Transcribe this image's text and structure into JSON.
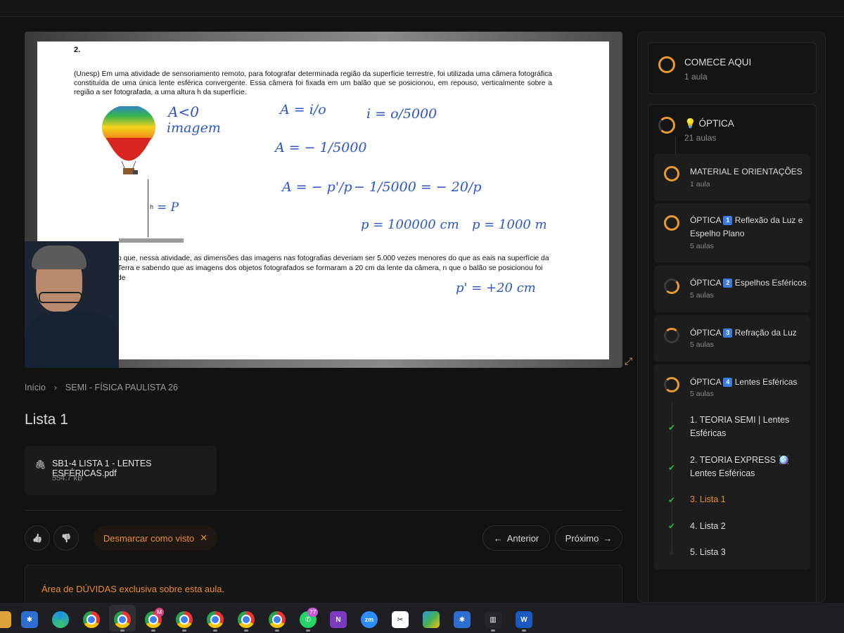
{
  "video": {
    "question_number": "2.",
    "question_text": "(Unesp)  Em uma atividade de sensoriamento remoto, para fotografar determinada região da superfície terrestre, foi utilizada uma câmera fotográfica constituída de uma única lente esférica convergente. Essa câmera foi fixada em um balão que se posicionou, em repouso, verticalmente sobre a região a ser fotografada, a uma altura h da superfície.",
    "question_text_2": "o que, nessa atividade, as dimensões das imagens nas fotografias deveriam ser 5.000 vezes menores do que as eais na superfície da Terra e sabendo que as imagens dos objetos fotografados se formaram a 20 cm da lente da câmera, n que o balão se posicionou foi de",
    "h_label": "h",
    "handwriting": {
      "a1": "A<0",
      "a2": "imagem",
      "a3": "A = i/o",
      "a4": "i = o/5000",
      "a5": "A = − 1/5000",
      "a6": "A = − p'/p",
      "a7": "− 1/5000 = − 20/p",
      "a8": "p = 100000 cm",
      "a9": "p = 1000 m",
      "a10": "p' = +20 cm",
      "a11": "= P"
    }
  },
  "breadcrumb": {
    "home": "Início",
    "course": "SEMI - FÍSICA PAULISTA 26"
  },
  "page_title": "Lista 1",
  "attachment": {
    "name": "SB1-4 LISTA 1 - LENTES ESFÉRICAS.pdf",
    "size": "554.7 kB"
  },
  "actions": {
    "unmark_label": "Desmarcar como visto",
    "unmark_icon": "✕",
    "prev_label": "Anterior",
    "next_label": "Próximo",
    "prev_icon": "←",
    "next_icon": "→",
    "like_icon": "👍",
    "dislike_icon": "👎"
  },
  "doubts": {
    "label": "Área de DÚVIDAS exclusiva sobre esta aula."
  },
  "sidebar": {
    "modules": [
      {
        "title": "COMECE AQUI",
        "subtitle": "1 aula"
      },
      {
        "title": "💡 ÓPTICA",
        "subtitle": "21 aulas"
      }
    ],
    "submodules": [
      {
        "title": "MATERIAL E ORIENTAÇÕES",
        "subtitle": "1 aula"
      },
      {
        "prefix": "ÓPTICA",
        "badge": "1",
        "title": "Reflexão da Luz e Espelho Plano",
        "subtitle": "5 aulas"
      },
      {
        "prefix": "ÓPTICA",
        "badge": "2",
        "title": "Espelhos Esféricos",
        "subtitle": "5 aulas"
      },
      {
        "prefix": "ÓPTICA",
        "badge": "3",
        "title": "Refração da Luz",
        "subtitle": "5 aulas"
      },
      {
        "prefix": "ÓPTICA",
        "badge": "4",
        "title": "Lentes Esféricas",
        "subtitle": "5 aulas"
      }
    ],
    "lessons": [
      {
        "label": "1. TEORIA SEMI | Lentes Esféricas",
        "done": true
      },
      {
        "label": "2. TEORIA EXPRESS 🪩 Lentes Esféricas",
        "done": true
      },
      {
        "label": "3. Lista 1",
        "done": true,
        "active": true
      },
      {
        "label": "4. Lista 2",
        "done": true
      },
      {
        "label": "5. Lista 3",
        "done": false
      }
    ]
  },
  "taskbar": {
    "whatsapp_badge": "77",
    "chrome_badge": "M"
  },
  "colors": {
    "accent": "#e88d2a",
    "check": "#2fae4b",
    "ink": "#2b57c9"
  }
}
